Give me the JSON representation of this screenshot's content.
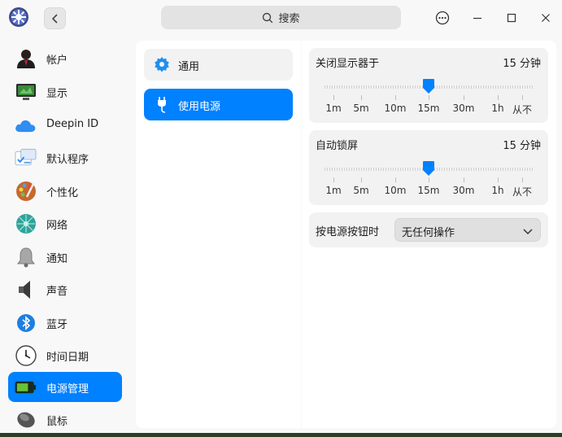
{
  "titlebar": {
    "search_label": "搜索"
  },
  "sidebar": {
    "items": [
      {
        "label": "帐户",
        "icon": "account-icon"
      },
      {
        "label": "显示",
        "icon": "display-icon"
      },
      {
        "label": "Deepin ID",
        "icon": "cloud-icon"
      },
      {
        "label": "默认程序",
        "icon": "default-apps-icon"
      },
      {
        "label": "个性化",
        "icon": "personalization-icon"
      },
      {
        "label": "网络",
        "icon": "network-icon"
      },
      {
        "label": "通知",
        "icon": "bell-icon"
      },
      {
        "label": "声音",
        "icon": "speaker-icon"
      },
      {
        "label": "蓝牙",
        "icon": "bluetooth-icon"
      },
      {
        "label": "时间日期",
        "icon": "clock-icon"
      },
      {
        "label": "电源管理",
        "icon": "battery-icon",
        "active": true
      },
      {
        "label": "鼠标",
        "icon": "mouse-icon"
      }
    ]
  },
  "power_menu": {
    "items": [
      {
        "label": "通用",
        "icon": "gear-icon"
      },
      {
        "label": "使用电源",
        "icon": "power-plug-icon",
        "active": true
      }
    ]
  },
  "settings": {
    "monitor_off": {
      "title": "关闭显示器于",
      "value": "15 分钟",
      "ticks": [
        "1m",
        "5m",
        "10m",
        "15m",
        "30m",
        "1h",
        "从不"
      ],
      "selected_index": 3
    },
    "auto_lock": {
      "title": "自动锁屏",
      "value": "15 分钟",
      "ticks": [
        "1m",
        "5m",
        "10m",
        "15m",
        "30m",
        "1h",
        "从不"
      ],
      "selected_index": 3
    },
    "power_button": {
      "title": "按电源按钮时",
      "value": "无任何操作"
    }
  },
  "colors": {
    "accent": "#0081ff",
    "card": "#f2f2f2",
    "panel": "#ffffff",
    "background": "#f8f8f8"
  }
}
